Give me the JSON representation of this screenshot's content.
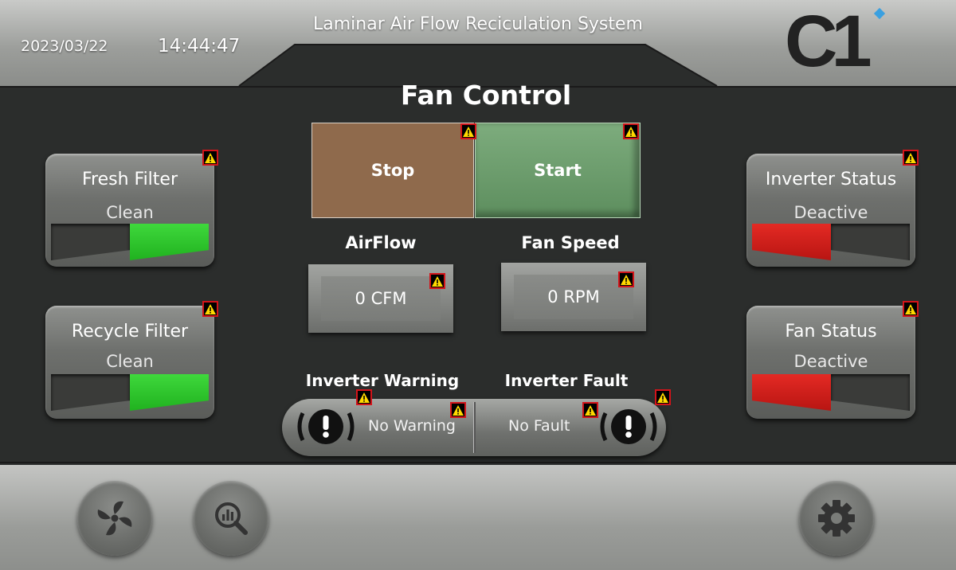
{
  "header": {
    "date": "2023/03/22",
    "time": "14:44:47",
    "system_title": "Laminar Air Flow Reciculation System",
    "logo_text": "C1"
  },
  "page_title": "Fan Control",
  "cards": {
    "fresh_filter": {
      "title": "Fresh Filter",
      "value": "Clean",
      "indicator": "green"
    },
    "recycle_filter": {
      "title": "Recycle Filter",
      "value": "Clean",
      "indicator": "green"
    },
    "inverter_status": {
      "title": "Inverter Status",
      "value": "Deactive",
      "indicator": "red"
    },
    "fan_status": {
      "title": "Fan Status",
      "value": "Deactive",
      "indicator": "red"
    }
  },
  "controls": {
    "stop_label": "Stop",
    "start_label": "Start"
  },
  "readouts": {
    "airflow_label": "AirFlow",
    "airflow_value": "0 CFM",
    "fan_speed_label": "Fan Speed",
    "fan_speed_value": "0 RPM"
  },
  "inverter": {
    "warning_label": "Inverter Warning",
    "warning_value": "No Warning",
    "fault_label": "Inverter Fault",
    "fault_value": "No Fault"
  },
  "footer": {
    "nav": [
      "fan-icon",
      "analytics-search-icon",
      "gear-icon"
    ]
  },
  "colors": {
    "background": "#2b2d2c",
    "ok_green": "#2ccb2a",
    "alarm_red": "#d61f1a",
    "stop_brown": "#8f6a4c",
    "start_green": "#6e9e6f",
    "warning_yellow": "#ffd800"
  }
}
